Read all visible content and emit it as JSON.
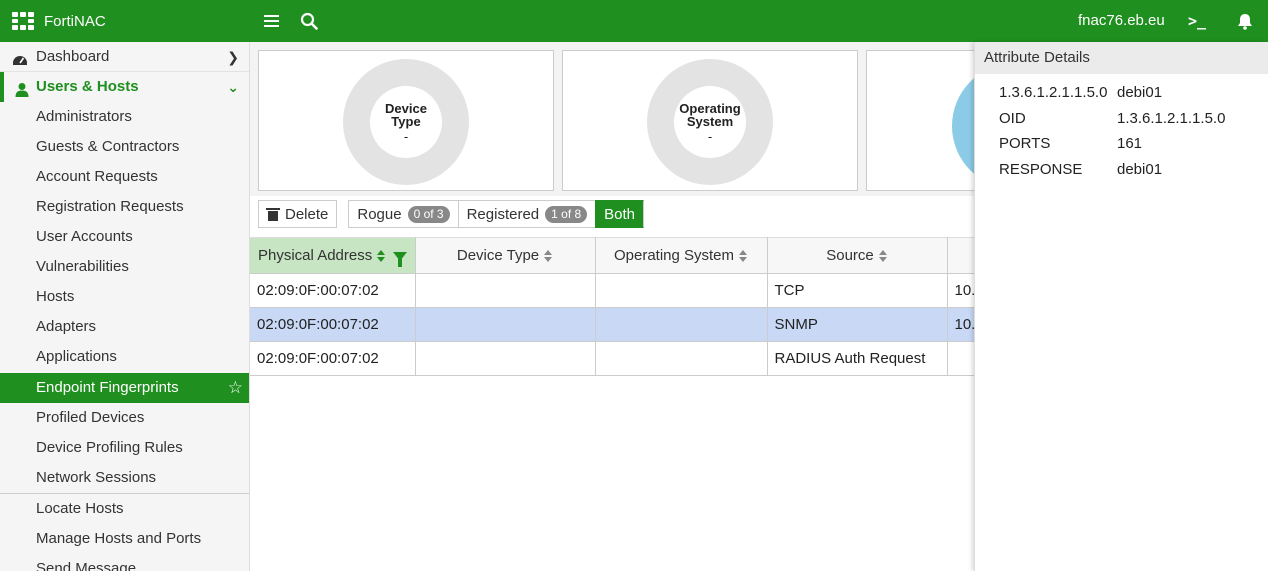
{
  "topbar": {
    "brand": "FortiNAC",
    "host": "fnac76.eb.eu",
    "icons": [
      "menu-icon",
      "search-icon",
      "terminal-icon",
      "bell-icon"
    ]
  },
  "sidebar": {
    "dashboard": "Dashboard",
    "section": "Users & Hosts",
    "items": [
      "Administrators",
      "Guests & Contractors",
      "Account Requests",
      "Registration Requests",
      "User Accounts",
      "Vulnerabilities",
      "Hosts",
      "Adapters",
      "Applications",
      "Endpoint Fingerprints",
      "Profiled Devices",
      "Device Profiling Rules",
      "Network Sessions",
      "Locate Hosts",
      "Manage Hosts and Ports",
      "Send Message"
    ],
    "active": "Endpoint Fingerprints"
  },
  "cards": [
    {
      "title_line1": "Device",
      "title_line2": "Type",
      "value": "-"
    },
    {
      "title_line1": "Operating",
      "title_line2": "System",
      "value": "-"
    }
  ],
  "toolbar": {
    "delete": "Delete",
    "rogue": "Rogue",
    "rogue_count": "0 of 3",
    "registered": "Registered",
    "registered_count": "1 of 8",
    "both": "Both"
  },
  "table": {
    "columns": [
      "Physical Address",
      "Device Type",
      "Operating System",
      "Source",
      ""
    ],
    "rows": [
      {
        "mac": "02:09:0F:00:07:02",
        "device_type": "",
        "os": "",
        "source": "TCP",
        "extra": "10."
      },
      {
        "mac": "02:09:0F:00:07:02",
        "device_type": "",
        "os": "",
        "source": "SNMP",
        "extra": "10."
      },
      {
        "mac": "02:09:0F:00:07:02",
        "device_type": "",
        "os": "",
        "source": "RADIUS Auth Request",
        "extra": ""
      }
    ]
  },
  "panel": {
    "title": "Attribute Details",
    "attributes": [
      {
        "key": "1.3.6.1.2.1.1.5.0",
        "value": "debi01"
      },
      {
        "key": "OID",
        "value": "1.3.6.1.2.1.1.5.0"
      },
      {
        "key": "PORTS",
        "value": "161"
      },
      {
        "key": "RESPONSE",
        "value": "debi01"
      }
    ]
  },
  "colors": {
    "accent": "#1f8f1f",
    "selected_row": "#c8d8f5",
    "sorted_header": "#c7e4c3",
    "chart_arc": "#8bcbe6"
  }
}
